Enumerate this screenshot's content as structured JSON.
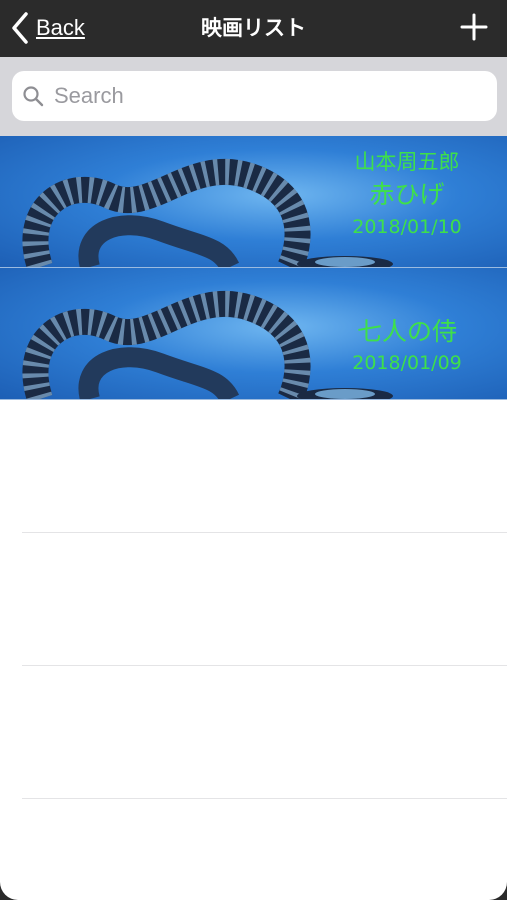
{
  "navbar": {
    "back_label": "Back",
    "title": "映画リスト",
    "add_icon": "plus-icon"
  },
  "search": {
    "placeholder": "Search",
    "value": ""
  },
  "movies": [
    {
      "director": "山本周五郎",
      "title": "赤ひげ",
      "date": "2018/01/10"
    },
    {
      "director": "",
      "title": "七人の侍",
      "date": "2018/01/09"
    }
  ],
  "colors": {
    "navbar_bg": "#2b2b2b",
    "search_bg": "#d6d6da",
    "row_text": "#3ee04a",
    "row_bg": "#2f7fd6"
  }
}
